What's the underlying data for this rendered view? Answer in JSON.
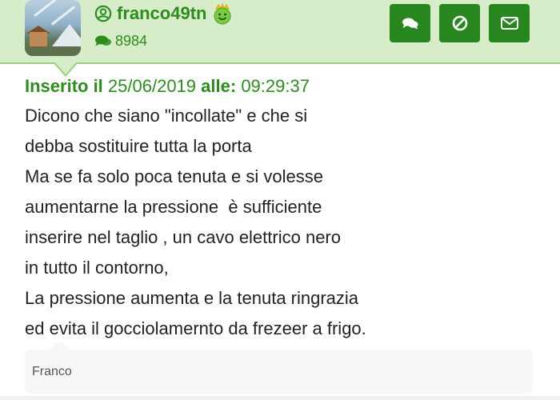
{
  "post": {
    "author": {
      "username": "franco49tn",
      "post_count": "8984",
      "badge": "crown-smiley"
    },
    "actions": [
      {
        "name": "chat",
        "icon": "chat-bubbles-icon"
      },
      {
        "name": "block",
        "icon": "ban-icon"
      },
      {
        "name": "message",
        "icon": "envelope-icon"
      }
    ],
    "meta": {
      "inserted_label": "Inserito il",
      "date": "25/06/2019",
      "time_label": "alle:",
      "time": "09:29:37"
    },
    "lines": [
      "Dicono che siano \"incollate\" e che si",
      "debba sostituire tutta la porta",
      "Ma se fa solo poca tenuta e si volesse",
      "aumentarne la pressione  è sufficiente",
      "inserire nel taglio , un cavo elettrico nero",
      "in tutto il contorno,",
      "La pressione aumenta e la tenuta ringrazia",
      "ed evita il gocciolamernto da frezeer a frigo."
    ],
    "signature": "Franco"
  },
  "colors": {
    "header_bg": "#d7ecc9",
    "accent_green": "#2e8b1e",
    "button_green": "#28861f",
    "text": "#222222"
  }
}
